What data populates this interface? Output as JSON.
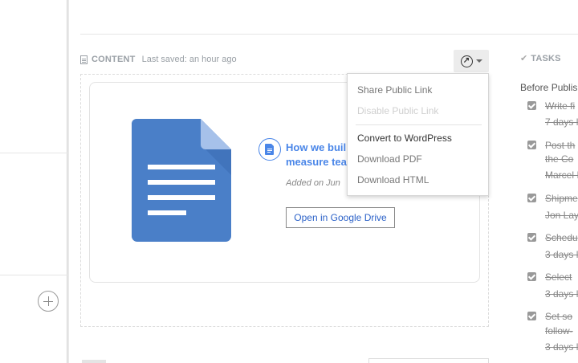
{
  "content_header": {
    "label": "CONTENT",
    "last_saved": "Last saved: an hour ago"
  },
  "document": {
    "title_line1": "How we buil",
    "title_line2": "measure tea",
    "added": "Added on Jun",
    "open_button": "Open in Google Drive"
  },
  "share_menu": {
    "items": [
      {
        "label": "Share Public Link",
        "state": "enabled"
      },
      {
        "label": "Disable Public Link",
        "state": "disabled"
      },
      {
        "label": "Convert to WordPress",
        "state": "highlighted"
      },
      {
        "label": "Download PDF",
        "state": "enabled"
      },
      {
        "label": "Download HTML",
        "state": "enabled"
      }
    ]
  },
  "tasks": {
    "header": "TASKS",
    "group": "Before Publis",
    "items": [
      {
        "line1": "Write fi",
        "line2": "7 days l"
      },
      {
        "line1": "Post th",
        "line2": "the Co",
        "line3": "Marcel I"
      },
      {
        "line1": "Shipme",
        "line2": "Jon Lay"
      },
      {
        "line1": "Schedu",
        "line2": "3 days l"
      },
      {
        "line1": "Select",
        "line2": "3 days l"
      },
      {
        "line1": "Set so",
        "line2": "follow-",
        "line3": "3 days l"
      }
    ]
  },
  "colors": {
    "accent": "#4a86e8",
    "doc_blue": "#4a7fc8",
    "muted_text": "#9aa0a6"
  },
  "icons": {
    "content": "document-icon",
    "share": "share-link-icon",
    "add": "plus-circle-icon",
    "tasks": "check-icon",
    "google_doc": "google-docs-icon",
    "doc_badge": "document-badge-icon"
  }
}
